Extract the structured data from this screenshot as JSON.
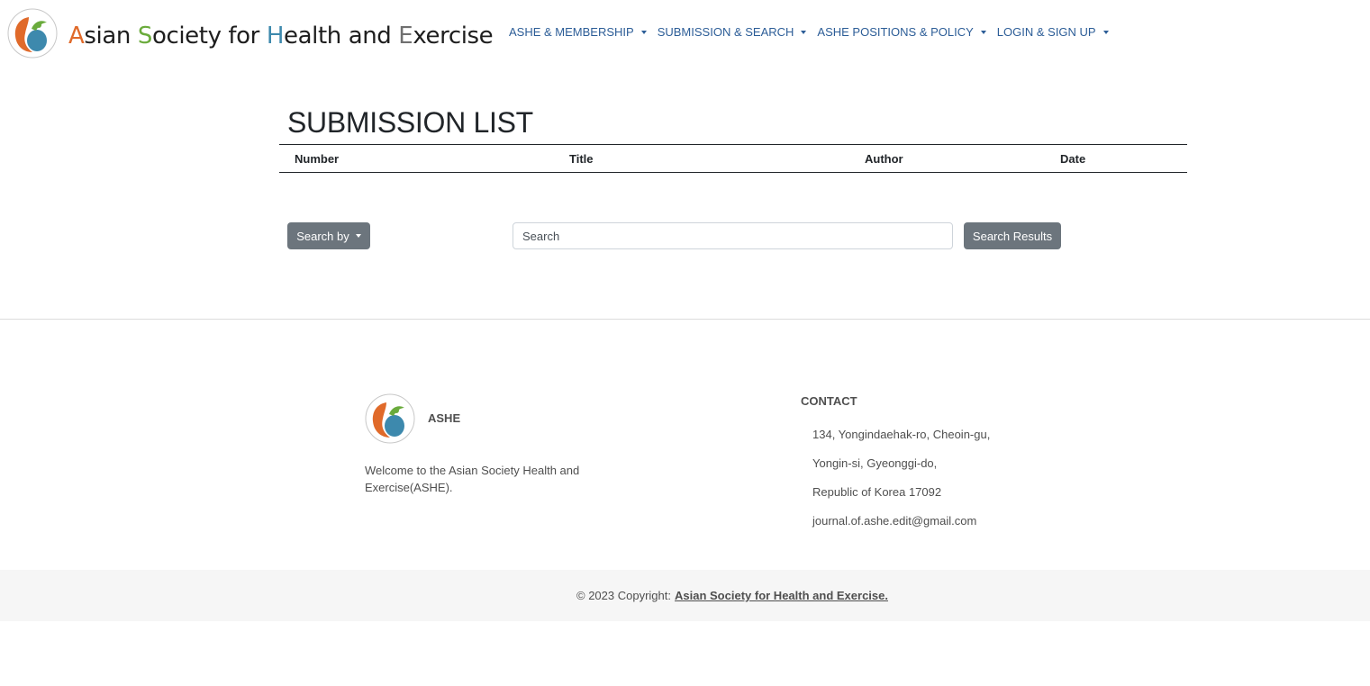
{
  "brand": {
    "name_parts": [
      "A",
      "sian ",
      "S",
      "ociety for ",
      "H",
      "ealth and ",
      "E",
      "xercise"
    ]
  },
  "nav": {
    "items": [
      {
        "label": "ASHE & MEMBERSHIP"
      },
      {
        "label": "SUBMISSION & SEARCH"
      },
      {
        "label": "ASHE POSITIONS & POLICY"
      },
      {
        "label": "LOGIN & SIGN UP"
      }
    ]
  },
  "main": {
    "title": "SUBMISSION LIST",
    "table": {
      "columns": [
        "Number",
        "Title",
        "Author",
        "Date"
      ],
      "rows": []
    },
    "search": {
      "search_by_label": "Search by",
      "placeholder": "Search",
      "results_label": "Search Results"
    }
  },
  "footer": {
    "brand": "ASHE",
    "welcome": "Welcome to the Asian Society Health and Exercise(ASHE).",
    "contact_heading": "CONTACT",
    "contact_lines": [
      "134, Yongindaehak-ro, Cheoin-gu,",
      "Yongin-si, Gyeonggi-do,",
      "Republic of Korea 17092",
      "journal.of.ashe.edit@gmail.com"
    ],
    "copyright_prefix": "© 2023 Copyright:",
    "copyright_link": "Asian Society for Health and Exercise."
  },
  "colors": {
    "nav_link": "#2c5d97",
    "button_gray": "#6c757d",
    "logo_orange": "#e06a2a",
    "logo_green": "#6aab3c",
    "logo_blue": "#3d89ad"
  },
  "icons": {
    "logo": "ashe-logo-icon",
    "dropdown": "caret-down-icon"
  }
}
